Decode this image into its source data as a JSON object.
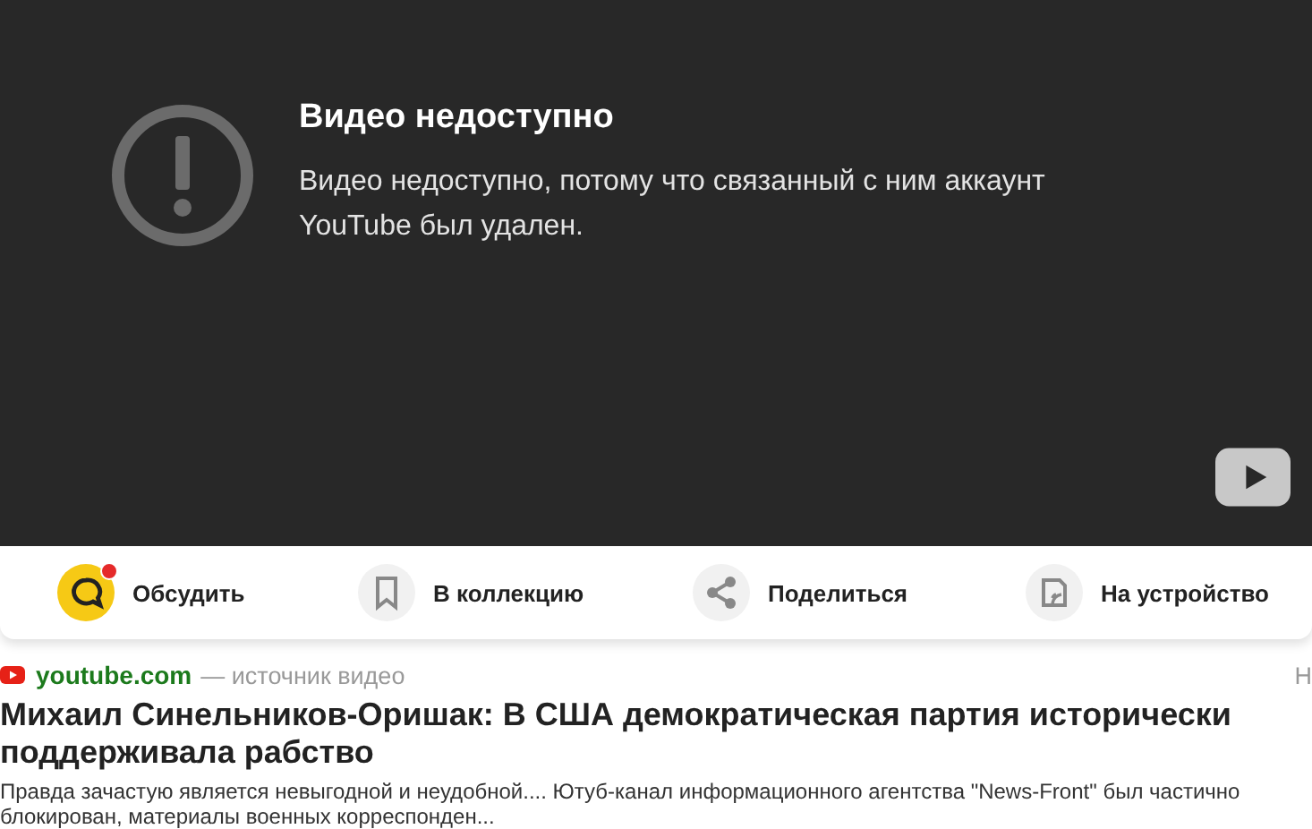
{
  "player": {
    "title": "Видео недоступно",
    "message": "Видео недоступно, потому что связанный с ним аккаунт YouTube был удален."
  },
  "actions": [
    {
      "kind": "discuss",
      "label": "Обсудить",
      "notification": true
    },
    {
      "kind": "collection",
      "label": "В коллекцию"
    },
    {
      "kind": "share",
      "label": "Поделиться"
    },
    {
      "kind": "device",
      "label": "На устройство"
    }
  ],
  "source": {
    "site": "youtube.com",
    "caption": "— источник видео",
    "column_2": "Н"
  },
  "article": {
    "title": "Михаил Синельников-Оришак: В США демократическая партия исторически поддерживала рабство",
    "snippet": "Правда зачастую является невыгодной и неудобной.... Ютуб-канал информационного агентства \"News-Front\" был частично блокирован, материалы военных корреспонден..."
  }
}
